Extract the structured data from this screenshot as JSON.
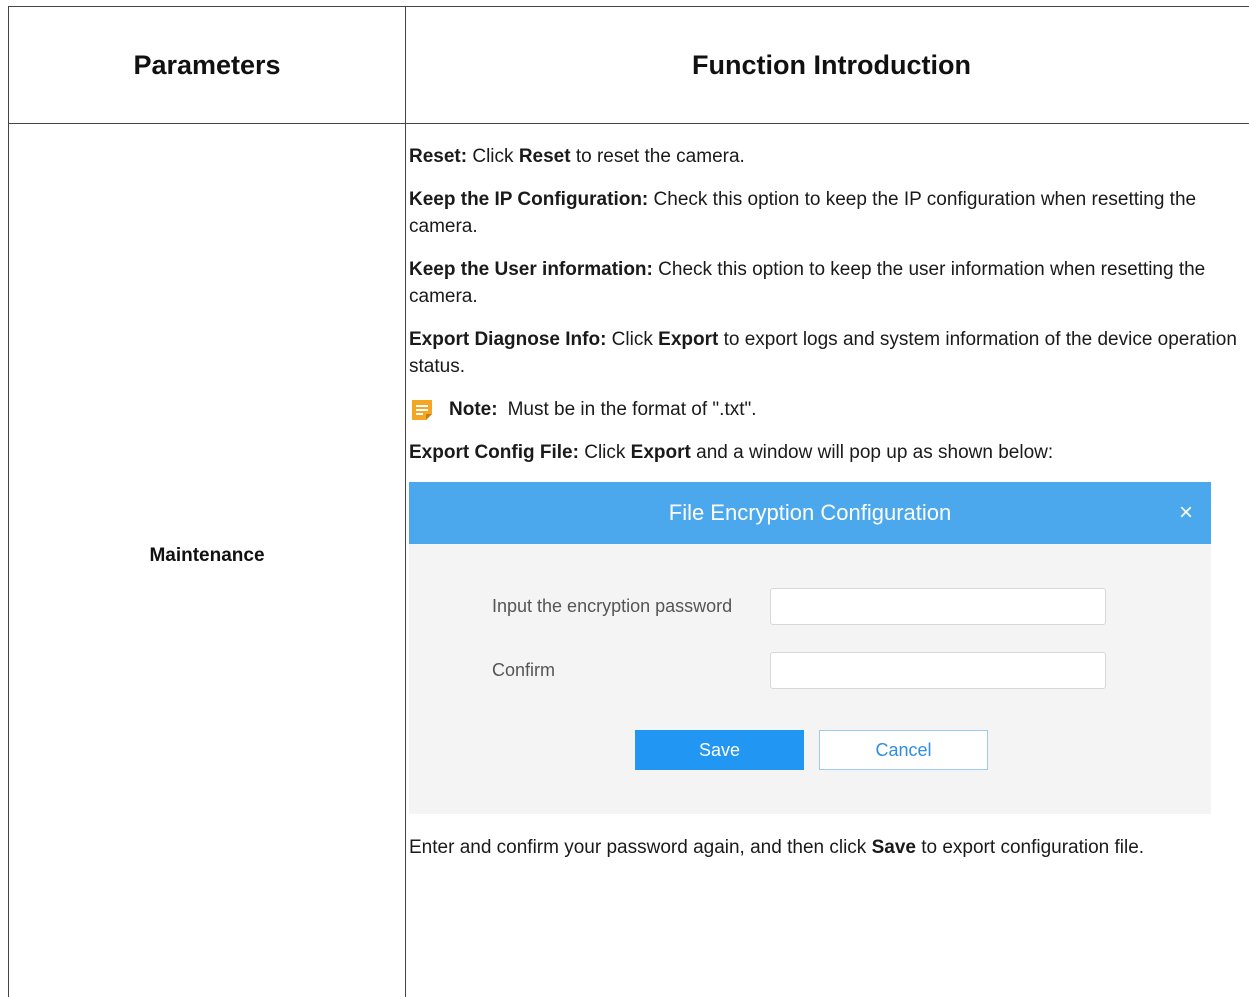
{
  "table": {
    "header_left": "Parameters",
    "header_right": "Function Introduction",
    "param_name": "Maintenance"
  },
  "items": [
    {
      "label": "Reset:",
      "pre": " Click ",
      "bold": "Reset",
      "post": " to reset the camera."
    },
    {
      "label": "Keep the IP Configuration:",
      "text": " Check this option to keep the IP configuration when resetting the camera."
    },
    {
      "label": "Keep the User information:",
      "text": " Check this option to keep the user information when resetting the camera."
    },
    {
      "label": "Export Diagnose Info:",
      "pre": " Click ",
      "bold": "Export",
      "post": " to export logs and system information of the device operation status."
    }
  ],
  "note": {
    "label": "Note:",
    "text": "Must be in the format of \".txt\"."
  },
  "export_config": {
    "label": "Export Config File:",
    "pre": " Click ",
    "bold": "Export",
    "post": " and a window will pop up as shown below:"
  },
  "dialog": {
    "title": "File Encryption Configuration",
    "close_symbol": "×",
    "password_label": "Input the encryption password",
    "password_value": "",
    "confirm_label": "Confirm",
    "confirm_value": "",
    "save_label": "Save",
    "cancel_label": "Cancel"
  },
  "closing": {
    "pre": "Enter and confirm your password again, and then click ",
    "bold": "Save",
    "post": " to export configuration file."
  },
  "colors": {
    "dialog_header": "#4ba8ec",
    "save_button": "#2196f3",
    "note_icon": "#f5a623"
  },
  "icons": {
    "note": "note-icon",
    "close": "close-icon"
  }
}
